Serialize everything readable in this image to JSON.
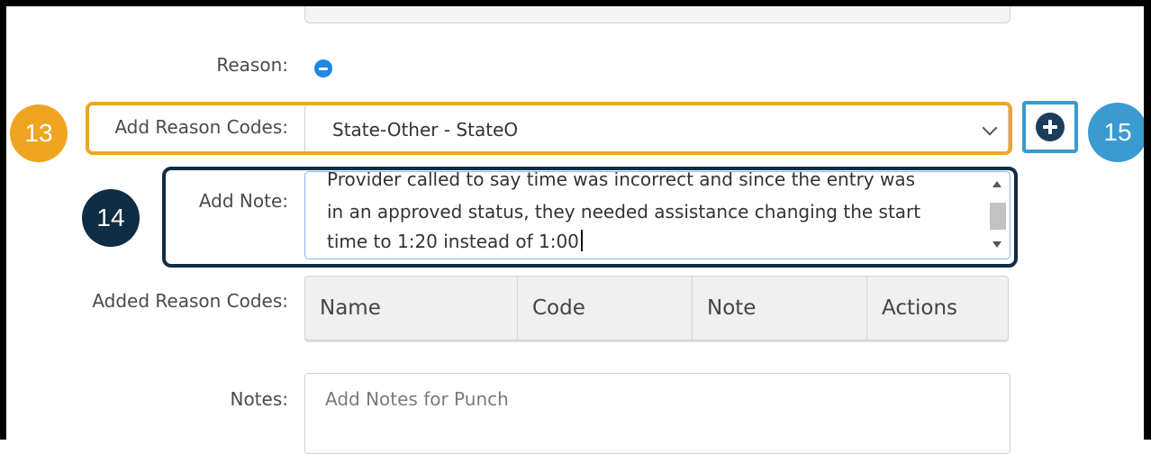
{
  "reason": {
    "label": "Reason:"
  },
  "add_reason_codes": {
    "label": "Add Reason Codes:",
    "selected": "State-Other - StateO"
  },
  "add_note": {
    "label": "Add Note:",
    "lines": [
      "Provider called to say time was incorrect and since the entry was",
      "in an approved status, they needed assistance changing the start",
      "time to 1:20 instead of 1:00"
    ]
  },
  "added_reason_codes": {
    "label": "Added Reason Codes:",
    "columns": [
      "Name",
      "Code",
      "Note",
      "Actions"
    ]
  },
  "notes": {
    "label": "Notes:",
    "placeholder": "Add Notes for Punch"
  },
  "callouts": {
    "add_reason_codes": "13",
    "add_note": "14",
    "add_button": "15"
  },
  "colors": {
    "callout_13": "#f0a522",
    "callout_14": "#0f2d44",
    "callout_15": "#3a9ad2",
    "remove_icon": "#1f88e5",
    "add_icon": "#1c3c5a"
  },
  "icons": {
    "remove": "minus-circle-icon",
    "add": "plus-circle-icon"
  }
}
